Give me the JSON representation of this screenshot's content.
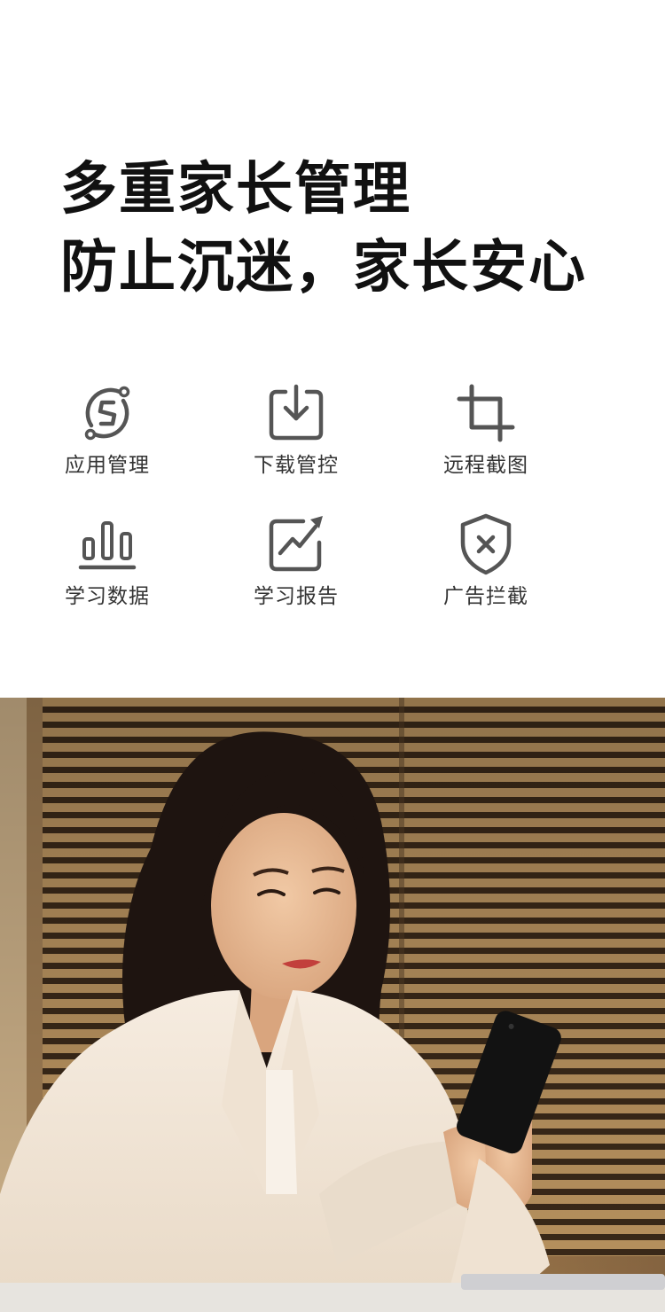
{
  "headline": {
    "line1": "多重家长管理",
    "line2": "防止沉迷，家长安心"
  },
  "features": [
    {
      "label": "应用管理",
      "icon": "app-switch-icon"
    },
    {
      "label": "下载管控",
      "icon": "download-tray-icon"
    },
    {
      "label": "远程截图",
      "icon": "crop-icon"
    },
    {
      "label": "学习数据",
      "icon": "bar-chart-icon"
    },
    {
      "label": "学习报告",
      "icon": "trend-report-icon"
    },
    {
      "label": "广告拦截",
      "icon": "shield-x-icon"
    }
  ],
  "colors": {
    "headline": "#111111",
    "icon_stroke": "#555555",
    "label": "#333333",
    "background": "#ffffff"
  },
  "photo": {
    "description_icon": "woman-using-phone-photo"
  }
}
